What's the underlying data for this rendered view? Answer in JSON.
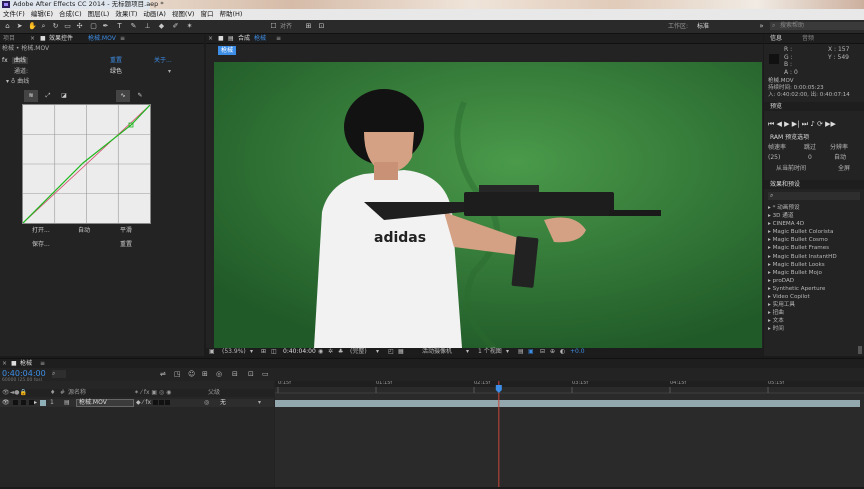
{
  "title_bar": {
    "title": "Adobe After Effects CC 2014 - 无标题项目.aep *"
  },
  "menu": [
    "文件(F)",
    "编辑(E)",
    "合成(C)",
    "图层(L)",
    "效果(T)",
    "动画(A)",
    "视图(V)",
    "窗口",
    "帮助(H)"
  ],
  "toolbar": {
    "snap_label": "对齐",
    "workspace_label": "工作区:",
    "workspace_value": "标准",
    "search_placeholder": "搜索帮助"
  },
  "effects_panel": {
    "tab_project": "项目",
    "tab_effects": "效果控件",
    "tab_effects_layer": "枪械.MOV",
    "breadcrumb": "枪械 • 枪械.MOV",
    "reset_label": "重置",
    "about_label": "关于...",
    "effect_name": "曲线",
    "channel_label": "通道:",
    "channel_value": "绿色",
    "section_label": "曲线",
    "buttons": {
      "open": "打开...",
      "auto": "自动",
      "smooth": "平滑",
      "save": "保存...",
      "reset": "重置"
    }
  },
  "viewer": {
    "tab_label": "合成",
    "tab_name": "枪械",
    "comp_chip": "枪械",
    "zoom": "(53.9%)",
    "timecode": "0:40:04:00",
    "resolution": "(完整)",
    "camera": "活动摄像机",
    "views": "1 个视图",
    "exposure": "+0.0"
  },
  "info_panel": {
    "tab_info": "信息",
    "tab_audio": "音频",
    "r": "R :",
    "g": "G :",
    "b": "B :",
    "a": "A : 0",
    "x": "X : 157",
    "y": "Y : 549",
    "clip_name": "枪械.MOV",
    "duration": "持续时间: 0:00:05:23",
    "in_out": "入: 0:40:02:00, 出: 0:40:07:14"
  },
  "preview_panel": {
    "tab": "预览",
    "ram_label": "RAM 预览选项",
    "frame_rate_label": "帧速率",
    "skip_label": "跳过",
    "resolution_label": "分辨率",
    "frame_rate_value": "(25)",
    "skip_value": "0",
    "resolution_value": "自动",
    "from_current": "从当前时间",
    "fullscreen": "全屏"
  },
  "effects_presets": {
    "tab": "效果和预设",
    "items": [
      "* 动画预设",
      "3D 通道",
      "CINEMA 4D",
      "Magic Bullet Colorista",
      "Magic Bullet Cosmo",
      "Magic Bullet Frames",
      "Magic Bullet InstantHD",
      "Magic Bullet Looks",
      "Magic Bullet Mojo",
      "proDAD",
      "Synthetic Aperture",
      "Video Copilot",
      "实用工具",
      "扭曲",
      "文本",
      "时间"
    ]
  },
  "timeline": {
    "tab": "枪械",
    "timecode": "0:40:04:00",
    "subcode": "60000 (25.00 fps)",
    "col_source": "源名称",
    "col_parent": "父级",
    "layer_num": "1",
    "layer_name": "枪械.MOV",
    "parent_value": "无",
    "ruler": [
      "0:15f",
      "01:15f",
      "02:15f",
      "03:15f",
      "04:15f",
      "05:15f"
    ],
    "playhead_progress": 0.38
  },
  "colors": {
    "accent": "#3d8ee6",
    "playhead": "#c5463b",
    "track_bar": "#92a8ae"
  }
}
